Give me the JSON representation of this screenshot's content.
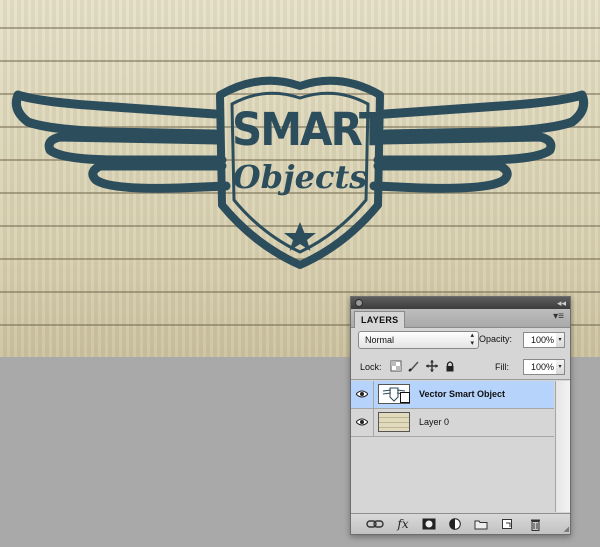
{
  "canvas": {
    "logo_line1": "SMART",
    "logo_line2": "Objects",
    "logo_color": "#2c4d5c"
  },
  "layers_panel": {
    "tab_label": "LAYERS",
    "blend_mode": "Normal",
    "opacity_label": "Opacity:",
    "opacity_value": "100%",
    "lock_label": "Lock:",
    "fill_label": "Fill:",
    "fill_value": "100%",
    "layers": [
      {
        "name": "Vector Smart Object",
        "selected": true,
        "type": "smart-object"
      },
      {
        "name": "Layer 0",
        "selected": false,
        "type": "raster"
      }
    ],
    "footer_icons": [
      "link-layers-icon",
      "fx-icon",
      "add-mask-icon",
      "adjustment-layer-icon",
      "new-group-icon",
      "new-layer-icon",
      "delete-layer-icon"
    ],
    "selection_color": "#b6d3fb"
  }
}
